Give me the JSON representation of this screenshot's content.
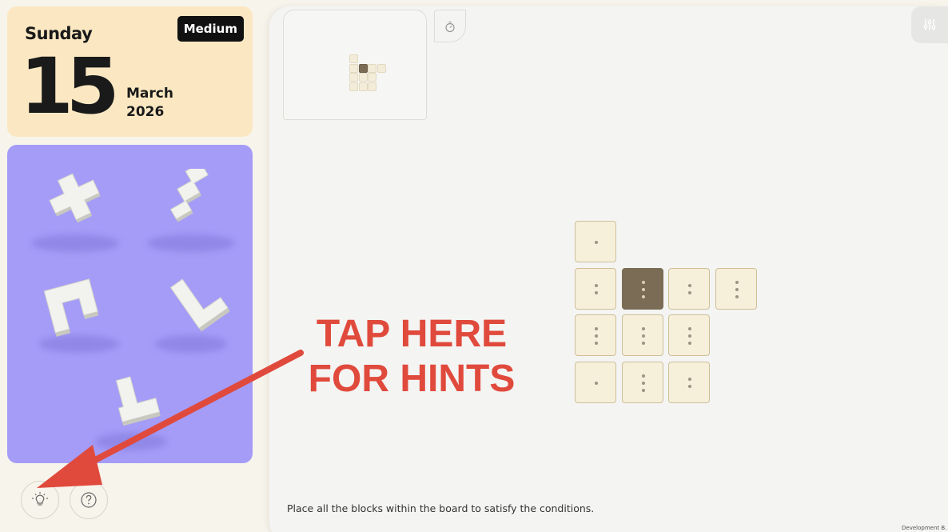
{
  "date_card": {
    "day": "Sunday",
    "difficulty": "Medium",
    "date": "15",
    "month": "March",
    "year": "2026"
  },
  "tray": {
    "pieces": [
      "plus-piece",
      "s-piece",
      "c-piece",
      "l-piece",
      "corner-piece"
    ]
  },
  "bottom_buttons": {
    "hint_icon": "lightbulb-icon",
    "help_icon": "question-mark-icon"
  },
  "toolbar": {
    "timer_icon": "stopwatch-icon",
    "settings_icon": "sliders-icon"
  },
  "board": {
    "rows": [
      [
        1,
        null,
        null,
        null
      ],
      [
        2,
        3,
        2,
        3
      ],
      [
        3,
        3,
        3,
        null
      ],
      [
        1,
        3,
        2,
        null
      ]
    ],
    "highlighted": [
      1,
      1
    ]
  },
  "instruction": "Place all the blocks within the board to satisfy the conditions.",
  "dev_badge": "Development B.",
  "annotation": {
    "line1": "TAP HERE",
    "line2": "FOR HINTS",
    "color": "#e04a3c"
  },
  "colors": {
    "date_card_bg": "#fbe8c2",
    "tray_bg": "#a49cf7",
    "cell_bg": "#f6efd9",
    "cell_dark": "#7b6c55"
  }
}
